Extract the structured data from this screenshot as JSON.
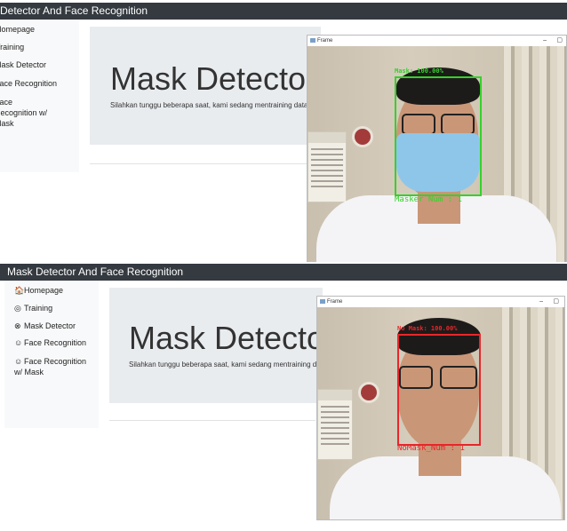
{
  "top": {
    "title": "Mask Detector And Face Recognition",
    "sidebar": [
      {
        "icon": "",
        "label": "Homepage"
      },
      {
        "icon": "",
        "label": "Training"
      },
      {
        "icon": "",
        "label": "Mask Detector"
      },
      {
        "icon": "",
        "label": "Face Recognition"
      },
      {
        "icon": "",
        "label": "Face Recognition w/ Mask"
      }
    ],
    "heading": "Mask Detector",
    "subtext": "Silahkan tunggu beberapa saat, kami sedang mentraining data,",
    "frame": {
      "title": "Frame",
      "label": "Mask: 100.00%",
      "count": "Masker Num : 1",
      "box_color": "#35d12b"
    }
  },
  "bottom": {
    "title": "Mask Detector And Face Recognition",
    "sidebar": [
      {
        "icon": "🏠",
        "label": "Homepage"
      },
      {
        "icon": "◎",
        "label": "Training"
      },
      {
        "icon": "⊗",
        "label": "Mask Detector"
      },
      {
        "icon": "☺",
        "label": "Face Recognition"
      },
      {
        "icon": "☺",
        "label": "Face Recognition w/ Mask"
      }
    ],
    "heading": "Mask Detector",
    "subtext": "Silahkan tunggu beberapa saat, kami sedang mentraining data,",
    "frame": {
      "title": "Frame",
      "label": "No Mask: 100.00%",
      "count": "NoMask_Num : 1",
      "box_color": "#e8262a"
    }
  }
}
